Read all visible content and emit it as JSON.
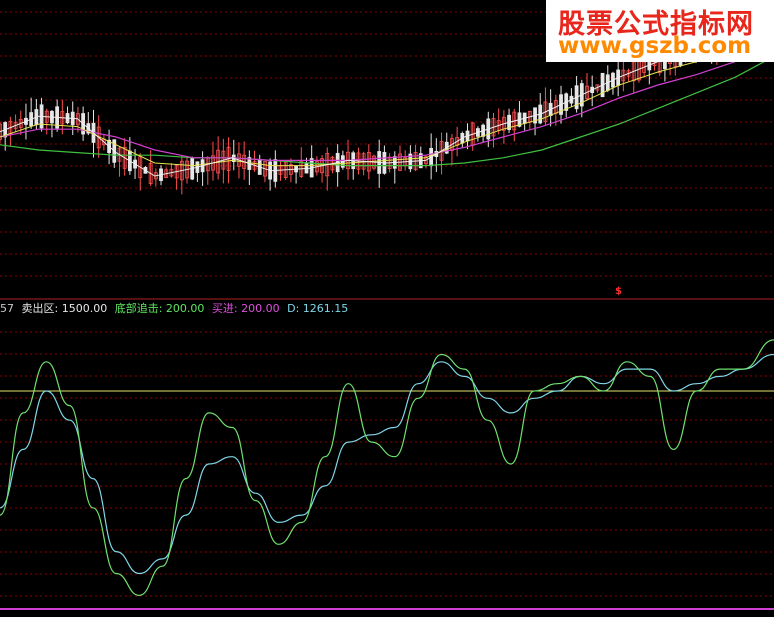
{
  "logo": {
    "line1": "股票公式指标网",
    "line2": "www.gszb.com"
  },
  "signal_marker": "$",
  "legend": {
    "prefix": "57",
    "sell_label": "卖出区: 1500.00",
    "bottom_label": "底部追击: 200.00",
    "buy_label": "买进: 200.00",
    "d_label": "D: 1261.15"
  },
  "colors": {
    "background": "#000000",
    "grid_dash": "#8b0000",
    "separator": "#b02020",
    "prefix": "#c8c8c8",
    "sell": "#e6e6e6",
    "bottom": "#5ee65e",
    "buy": "#e050e0",
    "d": "#7fd7e8",
    "candle_up": "#ff5050",
    "candle_down": "#e6e6e6",
    "ma_white": "#f0f0f0",
    "ma_yellow": "#e6e650",
    "ma_magenta": "#d040d0",
    "ma_green": "#40c040",
    "osc_green": "#70e070",
    "osc_cyan": "#7fd7e8",
    "ref_line": "#e6e670",
    "base_line": "#d040d0"
  },
  "chart_data": {
    "type": "line",
    "panels": [
      {
        "name": "price",
        "type": "candlestick",
        "ylim": [
          0,
          100
        ],
        "series_kind": [
          "ma_white",
          "ma_yellow",
          "ma_magenta",
          "ma_green"
        ],
        "x": [
          0,
          0.05,
          0.1,
          0.15,
          0.2,
          0.25,
          0.3,
          0.35,
          0.4,
          0.45,
          0.5,
          0.55,
          0.6,
          0.65,
          0.7,
          0.75,
          0.8,
          0.85,
          0.9,
          0.95,
          1.0
        ],
        "ma_fast": [
          57,
          63,
          62,
          49,
          40,
          43,
          47,
          42,
          43,
          46,
          45,
          46,
          55,
          60,
          64,
          71,
          78,
          84,
          88,
          92,
          104
        ],
        "ma_mid": [
          55,
          60,
          59,
          52,
          45,
          44,
          46,
          44,
          44,
          45,
          46,
          47,
          53,
          58,
          62,
          68,
          75,
          80,
          84,
          89,
          98
        ],
        "ma_slow": [
          55,
          58,
          58,
          55,
          50,
          47,
          47,
          46,
          46,
          46,
          47,
          48,
          51,
          55,
          59,
          64,
          70,
          75,
          79,
          84,
          92
        ],
        "ma_long": [
          52,
          50,
          49,
          48,
          48,
          47,
          47,
          46,
          45,
          44,
          44,
          44,
          45,
          47,
          50,
          55,
          60,
          66,
          72,
          78,
          86
        ]
      },
      {
        "name": "oscillator",
        "ylim": [
          0,
          2000
        ],
        "reference_lines": {
          "sell_zone": 1500,
          "bottom": 200
        },
        "x": [
          0,
          0.03,
          0.06,
          0.09,
          0.12,
          0.15,
          0.18,
          0.21,
          0.24,
          0.27,
          0.3,
          0.33,
          0.36,
          0.39,
          0.42,
          0.45,
          0.48,
          0.51,
          0.54,
          0.57,
          0.6,
          0.63,
          0.66,
          0.69,
          0.72,
          0.75,
          0.78,
          0.81,
          0.84,
          0.87,
          0.9,
          0.93,
          0.96,
          1.0
        ],
        "osc_line": [
          650,
          1350,
          1700,
          1400,
          700,
          250,
          100,
          300,
          900,
          1350,
          1250,
          750,
          450,
          600,
          1050,
          1550,
          1150,
          1050,
          1450,
          1750,
          1650,
          1300,
          1000,
          1500,
          1550,
          1600,
          1500,
          1700,
          1600,
          1100,
          1500,
          1650,
          1650,
          1850
        ],
        "d_line": [
          700,
          1100,
          1500,
          1300,
          900,
          400,
          250,
          350,
          650,
          1000,
          1050,
          800,
          600,
          650,
          850,
          1150,
          1200,
          1250,
          1550,
          1700,
          1600,
          1450,
          1350,
          1450,
          1500,
          1600,
          1550,
          1650,
          1650,
          1500,
          1550,
          1600,
          1650,
          1750
        ]
      }
    ]
  }
}
